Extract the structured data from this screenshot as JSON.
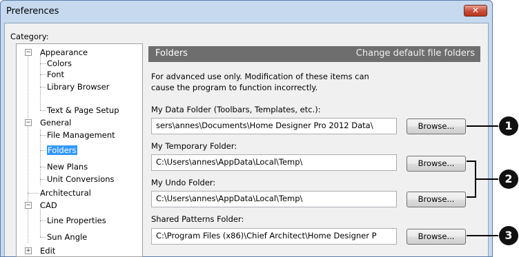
{
  "window": {
    "title": "Preferences",
    "close_label": "✕"
  },
  "category_label": "Category:",
  "tree": [
    {
      "label": "Appearance",
      "expander": "−"
    },
    {
      "label": "Colors"
    },
    {
      "label": "Font"
    },
    {
      "label": "Library Browser"
    },
    {
      "label": "Text & Page Setup"
    },
    {
      "label": "General",
      "expander": "−"
    },
    {
      "label": "File Management"
    },
    {
      "label": "Folders",
      "selected": true
    },
    {
      "label": "New Plans"
    },
    {
      "label": "Unit Conversions"
    },
    {
      "label": "Architectural"
    },
    {
      "label": "CAD",
      "expander": "−"
    },
    {
      "label": "Line Properties"
    },
    {
      "label": "Sun Angle"
    },
    {
      "label": "Edit",
      "expander": "+"
    }
  ],
  "panel": {
    "title": "Folders",
    "description": "Change default file folders",
    "note_line1": "For advanced use only. Modification of these items can",
    "note_line2": "cause the program to function incorrectly."
  },
  "fields": [
    {
      "label": "My Data Folder (Toolbars, Templates, etc.):",
      "value": "sers\\annes\\Documents\\Home Designer Pro 2012 Data\\",
      "button": "Browse..."
    },
    {
      "label": "My Temporary Folder:",
      "value": "C:\\Users\\annes\\AppData\\Local\\Temp\\",
      "button": "Browse..."
    },
    {
      "label": "My Undo Folder:",
      "value": "C:\\Users\\annes\\AppData\\Local\\Temp\\",
      "button": "Browse..."
    },
    {
      "label": "Shared Patterns Folder:",
      "value": "C:\\Program Files (x86)\\Chief Architect\\Home Designer P",
      "button": "Browse..."
    }
  ],
  "callouts": [
    "1",
    "2",
    "3"
  ]
}
